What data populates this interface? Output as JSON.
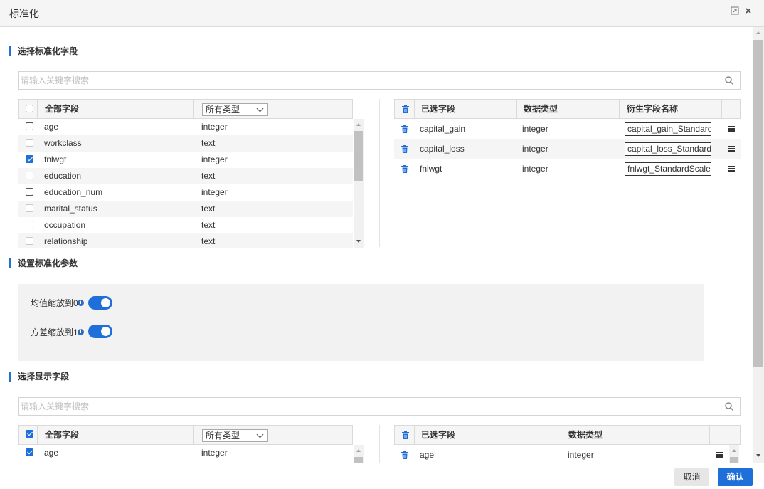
{
  "dialog": {
    "title": "标准化"
  },
  "section_fields": {
    "title": "选择标准化字段",
    "search_placeholder": "请输入关键字搜索"
  },
  "left_table": {
    "col_all": "全部字段",
    "type_filter": "所有类型",
    "rows": [
      {
        "name": "age",
        "type": "integer",
        "state": "unchecked"
      },
      {
        "name": "workclass",
        "type": "text",
        "state": "disabled"
      },
      {
        "name": "fnlwgt",
        "type": "integer",
        "state": "checked"
      },
      {
        "name": "education",
        "type": "text",
        "state": "disabled"
      },
      {
        "name": "education_num",
        "type": "integer",
        "state": "unchecked"
      },
      {
        "name": "marital_status",
        "type": "text",
        "state": "disabled"
      },
      {
        "name": "occupation",
        "type": "text",
        "state": "disabled"
      },
      {
        "name": "relationship",
        "type": "text",
        "state": "disabled"
      }
    ]
  },
  "right_table": {
    "col_selected": "已选字段",
    "col_type": "数据类型",
    "col_derived": "衍生字段名称",
    "rows": [
      {
        "name": "capital_gain",
        "type": "integer",
        "derived": "capital_gain_StandardScaled"
      },
      {
        "name": "capital_loss",
        "type": "integer",
        "derived": "capital_loss_StandardScaled"
      },
      {
        "name": "fnlwgt",
        "type": "integer",
        "derived": "fnlwgt_StandardScaled"
      }
    ]
  },
  "section_params": {
    "title": "设置标准化参数",
    "mean_label": "均值缩放到0",
    "mean_on": true,
    "std_label": "方差缩放到1",
    "std_on": true
  },
  "section_display": {
    "title": "选择显示字段",
    "search_placeholder": "请输入关键字搜索"
  },
  "display_left": {
    "col_all": "全部字段",
    "type_filter": "所有类型",
    "rows": [
      {
        "name": "age",
        "type": "integer",
        "state": "checked"
      }
    ]
  },
  "display_right": {
    "col_selected": "已选字段",
    "col_type": "数据类型",
    "rows": [
      {
        "name": "age",
        "type": "integer"
      }
    ]
  },
  "footer": {
    "cancel": "取消",
    "ok": "确认"
  },
  "colors": {
    "accent": "#1e6fd9",
    "header_bg": "#f5f5f5"
  }
}
